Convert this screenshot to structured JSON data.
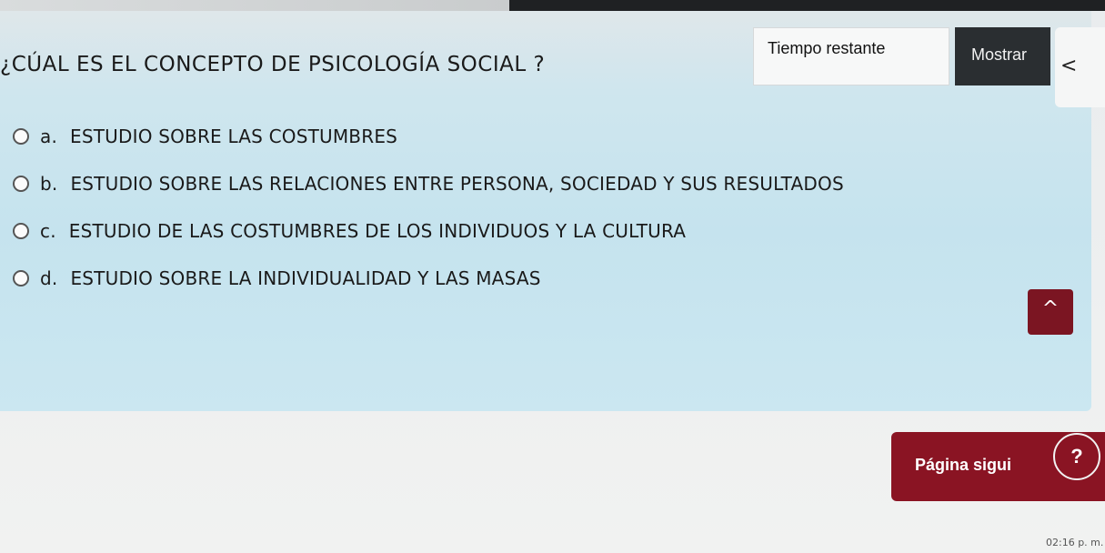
{
  "question": {
    "text": "¿CÚAL ES EL CONCEPTO DE PSICOLOGÍA SOCIAL ?"
  },
  "timer": {
    "label": "Tiempo restante"
  },
  "show_button": {
    "label": "Mostrar"
  },
  "collapse_tab": {
    "icon": "chevron-left-icon",
    "glyph": "<"
  },
  "options": [
    {
      "letter": "a.",
      "text": "ESTUDIO SOBRE LAS COSTUMBRES"
    },
    {
      "letter": "b.",
      "text": "ESTUDIO SOBRE LAS RELACIONES ENTRE PERSONA, SOCIEDAD Y SUS RESULTADOS"
    },
    {
      "letter": "c.",
      "text": "ESTUDIO DE LAS COSTUMBRES DE LOS INDIVIDUOS Y LA CULTURA"
    },
    {
      "letter": "d.",
      "text": "ESTUDIO SOBRE LA INDIVIDUALIDAD Y LAS MASAS"
    }
  ],
  "scroll_up": {
    "icon": "chevron-up-icon",
    "glyph": "^"
  },
  "next_button": {
    "label": "Página sigui"
  },
  "help_button": {
    "label": "?"
  },
  "clock": {
    "time": "02:16 p. m."
  },
  "colors": {
    "accent": "#8a1423",
    "dark_button": "#2a2e31",
    "panel": "#c5e3ee"
  }
}
